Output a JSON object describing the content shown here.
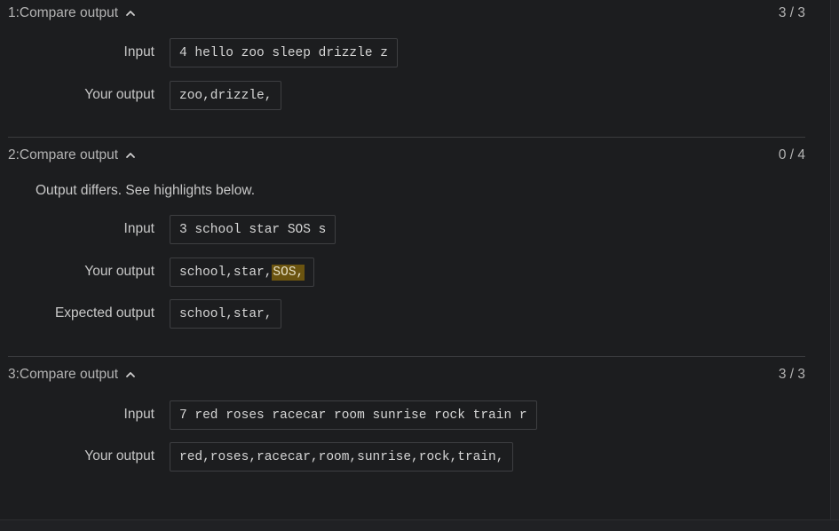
{
  "tests": [
    {
      "header": "1:Compare output",
      "score": "3 / 3",
      "message": "",
      "rows": {
        "input_label": "Input",
        "input_value": "4 hello zoo sleep drizzle z",
        "your_label": "Your output",
        "your_value": "zoo,drizzle,"
      }
    },
    {
      "header": "2:Compare output",
      "score": "0 / 4",
      "message": "Output differs. See highlights below.",
      "rows": {
        "input_label": "Input",
        "input_value": "3 school star SOS s",
        "your_label": "Your output",
        "your_value_plain": "school,star,",
        "your_value_highlight": "SOS,",
        "expected_label": "Expected output",
        "expected_value": "school,star,"
      }
    },
    {
      "header": "3:Compare output",
      "score": "3 / 3",
      "message": "",
      "rows": {
        "input_label": "Input",
        "input_value": "7 red roses racecar room sunrise rock train r",
        "your_label": "Your output",
        "your_value": "red,roses,racecar,room,sunrise,rock,train,"
      }
    }
  ],
  "icons": {
    "collapse": "chevron-up-icon"
  },
  "colors": {
    "background": "#1c1d1f",
    "highlight": "#6b5410"
  }
}
